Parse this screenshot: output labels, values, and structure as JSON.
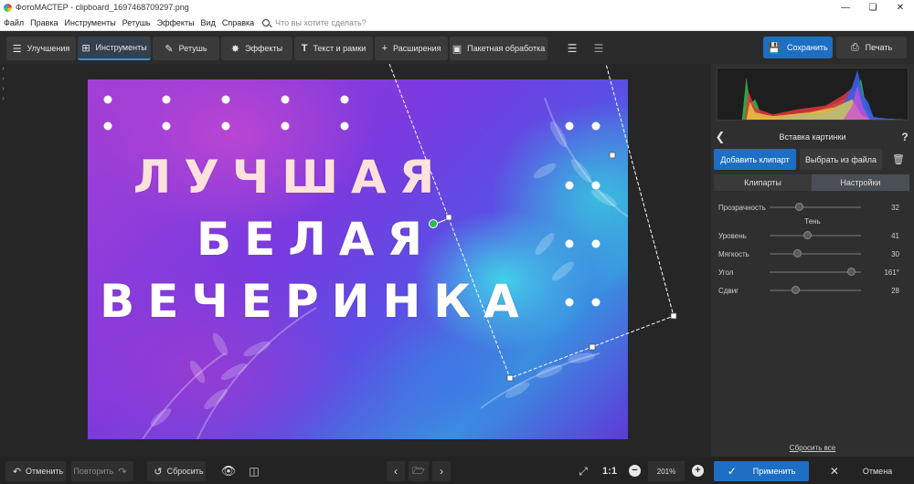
{
  "window": {
    "title": "ФотоМАСТЕР - clipboard_1697468709297.png",
    "minimize_icon": "minimize-icon",
    "maximize_icon": "maximize-icon",
    "close_icon": "close-icon"
  },
  "menu": {
    "items": [
      "Файл",
      "Правка",
      "Инструменты",
      "Ретушь",
      "Эффекты",
      "Вид",
      "Справка"
    ],
    "search_placeholder": "Что вы хотите сделать?"
  },
  "toolbar": {
    "tabs": [
      {
        "label": "Улучшения",
        "icon": "sliders-icon",
        "active": false
      },
      {
        "label": "Инструменты",
        "icon": "crop-icon",
        "active": true
      },
      {
        "label": "Ретушь",
        "icon": "brush-icon",
        "active": false
      },
      {
        "label": "Эффекты",
        "icon": "magic-wand-icon",
        "active": false
      },
      {
        "label": "Текст и рамки",
        "icon": "text-icon",
        "active": false
      },
      {
        "label": "Расширения",
        "icon": "plus-icon",
        "active": false
      },
      {
        "label": "Пакетная обработка",
        "icon": "image-stack-icon",
        "active": false
      }
    ],
    "save_label": "Сохранить",
    "print_label": "Печать"
  },
  "photo": {
    "line1": "ЛУЧШАЯ",
    "line2": "БЕЛАЯ",
    "line3": "ВЕЧЕРИНКА"
  },
  "panel": {
    "title": "Вставка картинки",
    "add_clipart": "Добавить клипарт",
    "from_file": "Выбрать из файла",
    "subtab_cliparts": "Клипарты",
    "subtab_settings": "Настройки",
    "active_subtab": "Настройки",
    "opacity_label": "Прозрачность",
    "opacity_value": "32",
    "shadow_heading": "Тень",
    "sliders": [
      {
        "label": "Уровень",
        "value": "41",
        "fraction": 0.41
      },
      {
        "label": "Мягкость",
        "value": "30",
        "fraction": 0.3
      },
      {
        "label": "Угол",
        "value": "161°",
        "fraction": 0.89
      },
      {
        "label": "Сдвиг",
        "value": "28",
        "fraction": 0.28
      }
    ],
    "opacity_fraction": 0.32,
    "reset_all": "Сбросить все"
  },
  "bottom": {
    "undo": "Отменить",
    "redo": "Повторить",
    "reset": "Сбросить",
    "zoom_one_to_one": "1:1",
    "zoom_value": "201%",
    "apply": "Применить",
    "cancel": "Отмена"
  },
  "colors": {
    "accent": "#1d6fc4",
    "background": "#2b2b2b",
    "panel": "#2f2f2f"
  }
}
